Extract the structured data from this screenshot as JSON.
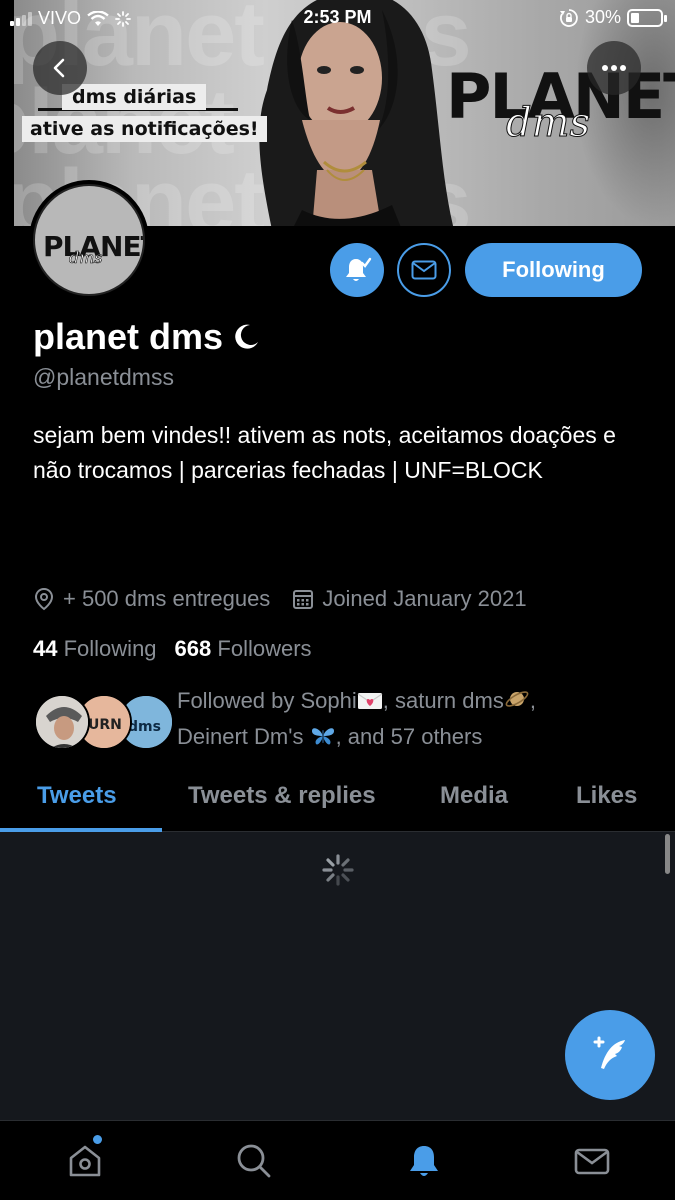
{
  "status_bar": {
    "carrier": "VIVO",
    "time": "2:53 PM",
    "battery_text": "30%",
    "battery_level": 0.3
  },
  "banner": {
    "label_line1": "dms diárias",
    "label_line2": "ative as notificações!",
    "logo_main": "PLANET",
    "logo_sub": "dms"
  },
  "avatar": {
    "logo_main": "PLANET",
    "logo_sub": "dms"
  },
  "actions": {
    "follow_label": "Following"
  },
  "profile": {
    "display_name": "planet dms",
    "handle": "@planetdmss",
    "bio": "sejam bem vindes!! ativem as nots, aceitamos doações e não trocamos | parcerias fechadas | UNF=BLOCK",
    "location": "+ 500 dms entregues",
    "joined": "Joined January 2021"
  },
  "counts": {
    "following_count": "44",
    "following_label": "Following",
    "followers_count": "668",
    "followers_label": "Followers"
  },
  "followed_by": {
    "prefix": "Followed by Sophi",
    "mid1": ", saturn dms",
    "mid2": ",",
    "line2_name": "Deinert Dm's",
    "suffix": ", and 57 others"
  },
  "tabs": [
    {
      "label": "Tweets",
      "active": true
    },
    {
      "label": "Tweets & replies",
      "active": false
    },
    {
      "label": "Media",
      "active": false
    },
    {
      "label": "Likes",
      "active": false
    }
  ],
  "colors": {
    "accent": "#4a9de8",
    "background": "#000000",
    "secondary_text": "#8a8f96"
  },
  "icons": {
    "back": "chevron-left-icon",
    "more": "more-dots-icon",
    "notify": "bell-check-icon",
    "message": "envelope-icon",
    "location": "location-pin-icon",
    "calendar": "calendar-icon",
    "compose": "compose-feather-icon",
    "nav_home": "home-icon",
    "nav_search": "search-icon",
    "nav_notifications": "bell-icon",
    "nav_messages": "envelope-icon"
  }
}
